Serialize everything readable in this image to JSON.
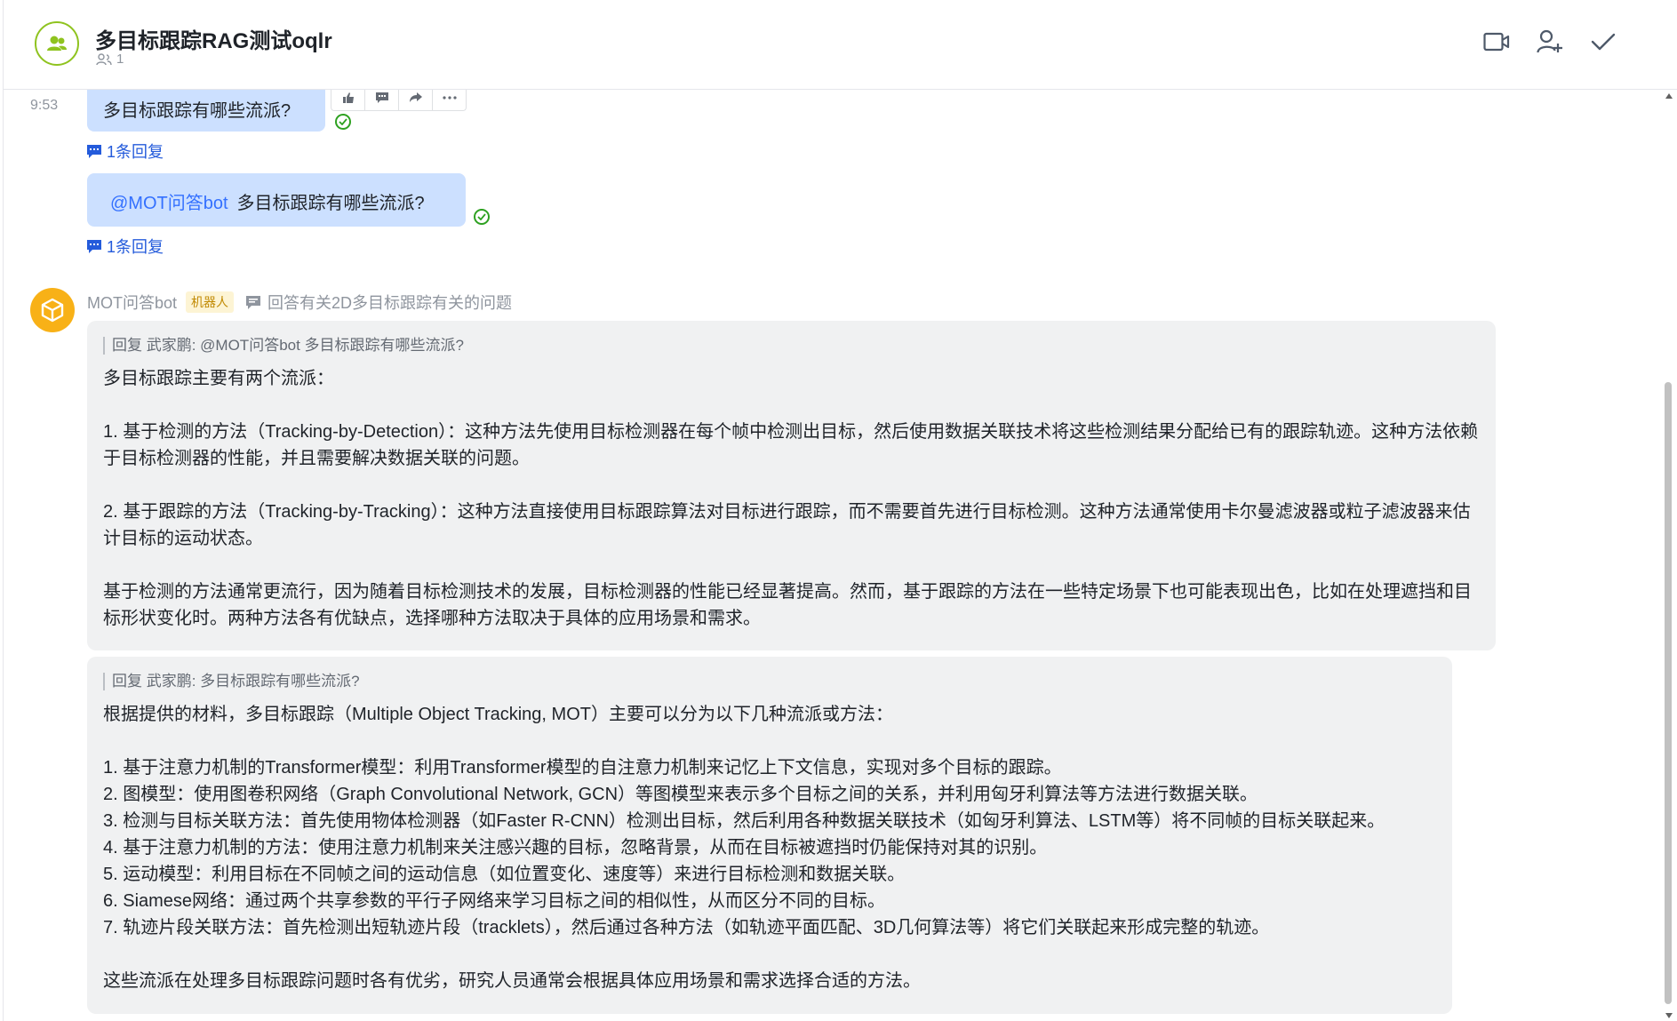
{
  "header": {
    "title": "多目标跟踪RAG测试oqlr",
    "member_count": "1",
    "icons": [
      "video-call-icon",
      "add-member-icon",
      "done-check-icon"
    ]
  },
  "messages": {
    "time": "9:53",
    "msg1": {
      "text": "多目标跟踪有哪些流派?",
      "reply_count": "1条回复"
    },
    "msg2": {
      "mention": "@MOT问答bot",
      "text": "多目标跟踪有哪些流派?",
      "reply_count": "1条回复"
    }
  },
  "bot": {
    "name": "MOT问答bot",
    "tag": "机器人",
    "description": "回答有关2D多目标跟踪有关的问题",
    "avatar_color": "#f8b117"
  },
  "answer1": {
    "quote": "回复 武家鹏: @MOT问答bot 多目标跟踪有哪些流派?",
    "intro": "多目标跟踪主要有两个流派：",
    "point1": "1. 基于检测的方法（Tracking-by-Detection）：这种方法先使用目标检测器在每个帧中检测出目标，然后使用数据关联技术将这些检测结果分配给已有的跟踪轨迹。这种方法依赖于目标检测器的性能，并且需要解决数据关联的问题。",
    "point2": "2. 基于跟踪的方法（Tracking-by-Tracking）：这种方法直接使用目标跟踪算法对目标进行跟踪，而不需要首先进行目标检测。这种方法通常使用卡尔曼滤波器或粒子滤波器来估计目标的运动状态。",
    "conclusion": "基于检测的方法通常更流行，因为随着目标检测技术的发展，目标检测器的性能已经显著提高。然而，基于跟踪的方法在一些特定场景下也可能表现出色，比如在处理遮挡和目标形状变化时。两种方法各有优缺点，选择哪种方法取决于具体的应用场景和需求。"
  },
  "answer2": {
    "quote": "回复 武家鹏: 多目标跟踪有哪些流派?",
    "intro": "根据提供的材料，多目标跟踪（Multiple Object Tracking, MOT）主要可以分为以下几种流派或方法：",
    "items": [
      "1. 基于注意力机制的Transformer模型：利用Transformer模型的自注意力机制来记忆上下文信息，实现对多个目标的跟踪。",
      "2. 图模型：使用图卷积网络（Graph Convolutional Network, GCN）等图模型来表示多个目标之间的关系，并利用匈牙利算法等方法进行数据关联。",
      "3. 检测与目标关联方法：首先使用物体检测器（如Faster R-CNN）检测出目标，然后利用各种数据关联技术（如匈牙利算法、LSTM等）将不同帧的目标关联起来。",
      "4. 基于注意力机制的方法：使用注意力机制来关注感兴趣的目标，忽略背景，从而在目标被遮挡时仍能保持对其的识别。",
      "5. 运动模型：利用目标在不同帧之间的运动信息（如位置变化、速度等）来进行目标检测和数据关联。",
      "6. Siamese网络：通过两个共享参数的平行子网络来学习目标之间的相似性，从而区分不同的目标。",
      "7. 轨迹片段关联方法：首先检测出短轨迹片段（tracklets），然后通过各种方法（如轨迹平面匹配、3D几何算法等）将它们关联起来形成完整的轨迹。"
    ],
    "conclusion": "这些流派在处理多目标跟踪问题时各有优劣，研究人员通常会根据具体应用场景和需求选择合适的方法。"
  }
}
